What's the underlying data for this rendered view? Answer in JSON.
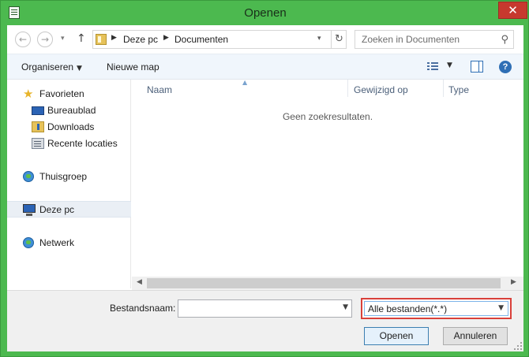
{
  "window": {
    "title": "Openen",
    "close_symbol": "✕"
  },
  "address_bar": {
    "back_symbol": "←",
    "forward_symbol": "→",
    "dropdown_symbol": "▾",
    "up_symbol": "↑",
    "breadcrumb": [
      "Deze pc",
      "Documenten"
    ],
    "crumb_separator": "▶",
    "refresh_symbol": "↻"
  },
  "search": {
    "placeholder": "Zoeken in Documenten",
    "icon_symbol": "⚲"
  },
  "toolbar": {
    "organize_label": "Organiseren",
    "new_folder_label": "Nieuwe map",
    "caret": "▼",
    "help_symbol": "?"
  },
  "nav_pane": {
    "favorites": {
      "label": "Favorieten",
      "items": [
        "Bureaublad",
        "Downloads",
        "Recente locaties"
      ]
    },
    "homegroup": "Thuisgroep",
    "this_pc": "Deze pc",
    "network": "Netwerk"
  },
  "columns": [
    "Naam",
    "Gewijzigd op",
    "Type"
  ],
  "sort_indicator": "▲",
  "empty_message": "Geen zoekresultaten.",
  "scrollbar": {
    "left_symbol": "◀",
    "right_symbol": "▶"
  },
  "bottom": {
    "filename_label": "Bestandsnaam:",
    "filename_value": "",
    "filter_value": "Alle bestanden(*.*)",
    "caret": "▼",
    "open_button": "Openen",
    "cancel_button": "Annuleren"
  },
  "colors": {
    "frame": "#4cb94f",
    "close": "#c7392e",
    "highlight": "#d9403a",
    "accent": "#2f6fb5"
  }
}
